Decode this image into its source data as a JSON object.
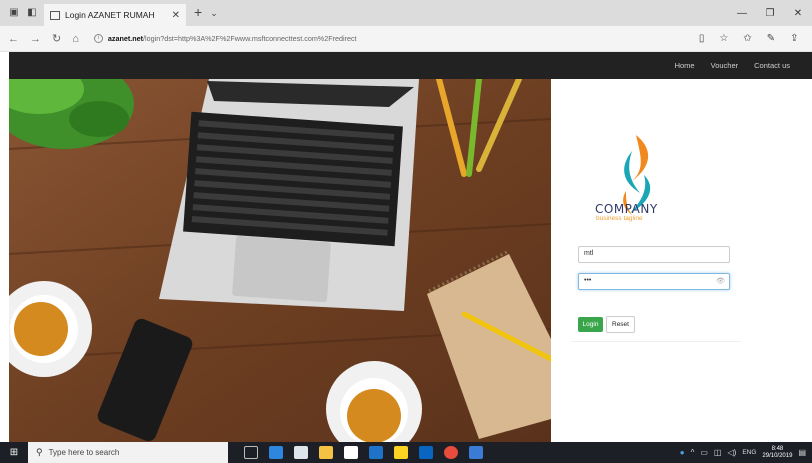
{
  "browser": {
    "tab_title": "Login AZANET RUMAH",
    "url_host": "azanet.net",
    "url_rest": "/login?dst=http%3A%2F%2Fwww.msftconnecttest.com%2Fredirect"
  },
  "site_nav": {
    "items": [
      "Home",
      "Voucher",
      "Contact us"
    ]
  },
  "login": {
    "logo_word": "COMPANY",
    "logo_tagline": "business tagline",
    "username_value": "mtl",
    "password_value": "•••",
    "login_label": "Login",
    "reset_label": "Reset"
  },
  "taskbar": {
    "search_placeholder": "Type here to search",
    "lang": "ENG",
    "time": "8:48",
    "date": "29/10/2019"
  },
  "colors": {
    "navbar": "#222222",
    "login_button": "#3aa64b",
    "logo_text": "#2f3a6b",
    "logo_tagline": "#f0a030",
    "taskbar": "#1c1f26"
  }
}
